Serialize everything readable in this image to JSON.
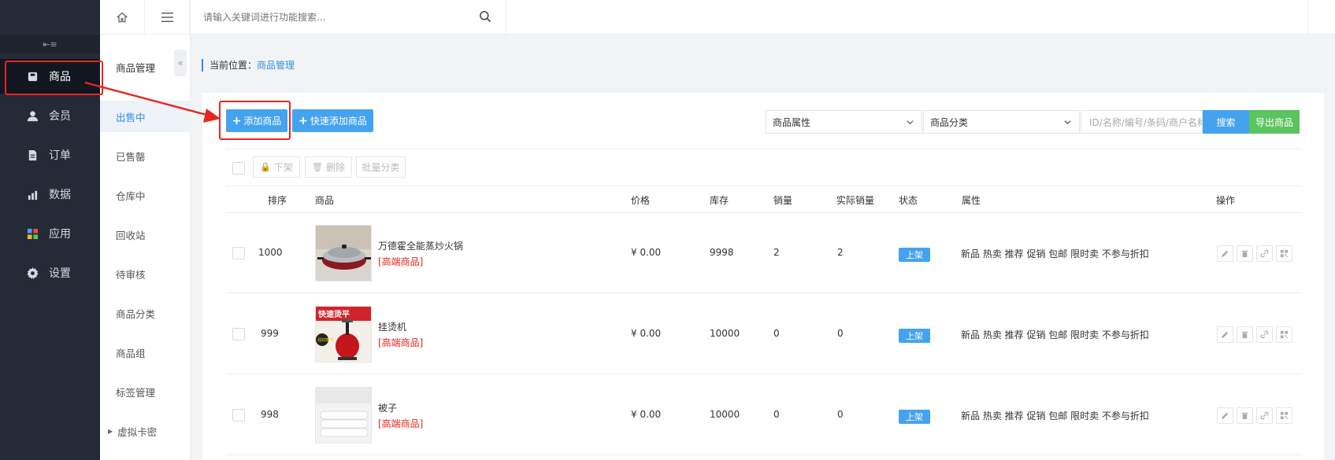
{
  "topbar": {
    "search_placeholder": "请输入关键词进行功能搜索..."
  },
  "sidebar": {
    "items": [
      {
        "label": "商品",
        "icon": "bag-icon"
      },
      {
        "label": "会员",
        "icon": "user-icon"
      },
      {
        "label": "订单",
        "icon": "document-icon"
      },
      {
        "label": "数据",
        "icon": "chart-icon"
      },
      {
        "label": "应用",
        "icon": "apps-icon"
      },
      {
        "label": "设置",
        "icon": "gear-icon"
      }
    ]
  },
  "subnav": {
    "title": "商品管理",
    "items": [
      {
        "label": "出售中"
      },
      {
        "label": "已售罄"
      },
      {
        "label": "仓库中"
      },
      {
        "label": "回收站"
      },
      {
        "label": "待审核"
      },
      {
        "label": "商品分类"
      },
      {
        "label": "商品组"
      },
      {
        "label": "标签管理"
      },
      {
        "label": "虚拟卡密"
      }
    ]
  },
  "breadcrumb": {
    "prefix": "当前位置：",
    "current": "商品管理"
  },
  "toolbar": {
    "add_label": "添加商品",
    "quick_add_label": "快速添加商品",
    "attr_select": "商品属性",
    "category_select": "商品分类",
    "keyword_placeholder": "ID/名称/编号/条码/商户名称",
    "search_label": "搜索",
    "export_label": "导出商品"
  },
  "batch": {
    "off_shelf": "下架",
    "delete": "删除",
    "batch_category": "批量分类"
  },
  "table": {
    "headers": {
      "sort": "排序",
      "product": "商品",
      "price": "价格",
      "stock": "库存",
      "sales": "销量",
      "real_sales": "实际销量",
      "status": "状态",
      "attrs": "属性",
      "actions": "操作"
    },
    "rows": [
      {
        "sort": "1000",
        "name": "万德霍全能蒸炒火锅",
        "tag": "[高端商品]",
        "price": "¥ 0.00",
        "stock": "9998",
        "sales": "2",
        "real_sales": "2",
        "status": "上架",
        "attrs": "新品 热卖 推荐 促销 包邮 限时卖 不参与折扣"
      },
      {
        "sort": "999",
        "name": "挂烫机",
        "tag": "[高端商品]",
        "price": "¥ 0.00",
        "stock": "10000",
        "sales": "0",
        "real_sales": "0",
        "status": "上架",
        "attrs": "新品 热卖 推荐 促销 包邮 限时卖 不参与折扣"
      },
      {
        "sort": "998",
        "name": "被子",
        "tag": "[高端商品]",
        "price": "¥ 0.00",
        "stock": "10000",
        "sales": "0",
        "real_sales": "0",
        "status": "上架",
        "attrs": "新品 热卖 推荐 促销 包邮 限时卖 不参与折扣"
      }
    ],
    "thumb_texts": {
      "steamer_banner": "快速烫平",
      "steamer_badge": "强劲蒸汽"
    }
  },
  "colors": {
    "primary": "#45a3ee",
    "success": "#5cc45e",
    "sidebar_bg": "#252b36",
    "highlight": "#e8261f",
    "tag_red": "#e8261f"
  }
}
